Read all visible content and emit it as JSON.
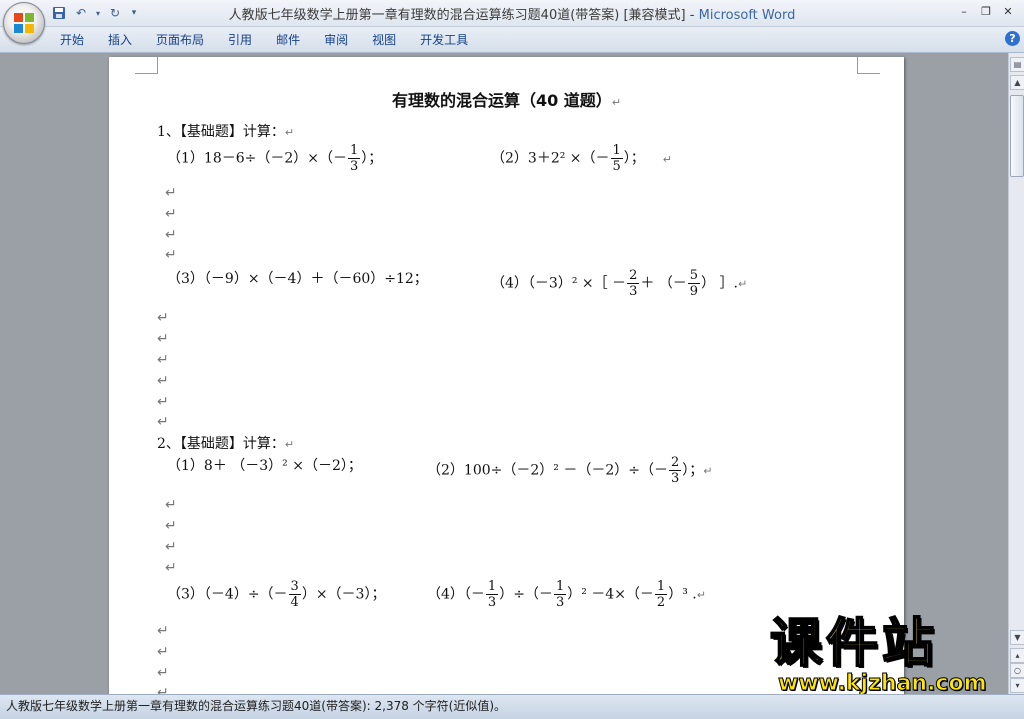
{
  "window": {
    "title_doc": "人教版七年级数学上册第一章有理数的混合运算练习题40道(带答案) [兼容模式]",
    "title_sep": " - ",
    "title_app": "Microsoft Word"
  },
  "ribbon": {
    "tabs": [
      "开始",
      "插入",
      "页面布局",
      "引用",
      "邮件",
      "审阅",
      "视图",
      "开发工具"
    ]
  },
  "doc": {
    "title": "有理数的混合运算（40 道题）",
    "mark": "↵",
    "q1": {
      "heading": "1、【基础题】计算：",
      "p1_a": "（1）18－6÷（－2）×（－",
      "p1_num": "1",
      "p1_den": "3",
      "p1_b": "）；",
      "p2_a": "（2）3＋2² ×（－",
      "p2_num": "1",
      "p2_den": "5",
      "p2_b": "）；",
      "p3": "（3）（－9）×（－4）＋（－60）÷12；",
      "p4_a": "（4）（－3）² ×［ －",
      "p4_num1": "2",
      "p4_den1": "3",
      "p4_b": "＋ （－",
      "p4_num2": "5",
      "p4_den2": "9",
      "p4_c": "） ］."
    },
    "q2": {
      "heading": "2、【基础题】计算：",
      "p1": "（1）8＋ （－3）² ×（－2）；",
      "p2_a": "（2）100÷（－2）² －（－2）÷（－",
      "p2_num": "2",
      "p2_den": "3",
      "p2_b": "）；",
      "p3_a": "（3）（－4）÷（－",
      "p3_num": "3",
      "p3_den": "4",
      "p3_b": "）×（－3）；",
      "p4_a": "（4）（－",
      "p4_num1": "1",
      "p4_den1": "3",
      "p4_b": "）÷（－",
      "p4_num2": "1",
      "p4_den2": "3",
      "p4_c": "）² －4×（－",
      "p4_num3": "1",
      "p4_den3": "2",
      "p4_d": "）³ ."
    }
  },
  "status": {
    "text": "人教版七年级数学上册第一章有理数的混合运算练习题40道(带答案): 2,378 个字符(近似值)。"
  },
  "watermark": {
    "cn": "课件站",
    "url": "www.kjzhan.com"
  },
  "icons": [
    "office-logo-icon",
    "save-icon",
    "undo-icon",
    "redo-icon",
    "customize-qat-icon",
    "minimize-icon",
    "restore-icon",
    "close-icon",
    "help-icon"
  ]
}
